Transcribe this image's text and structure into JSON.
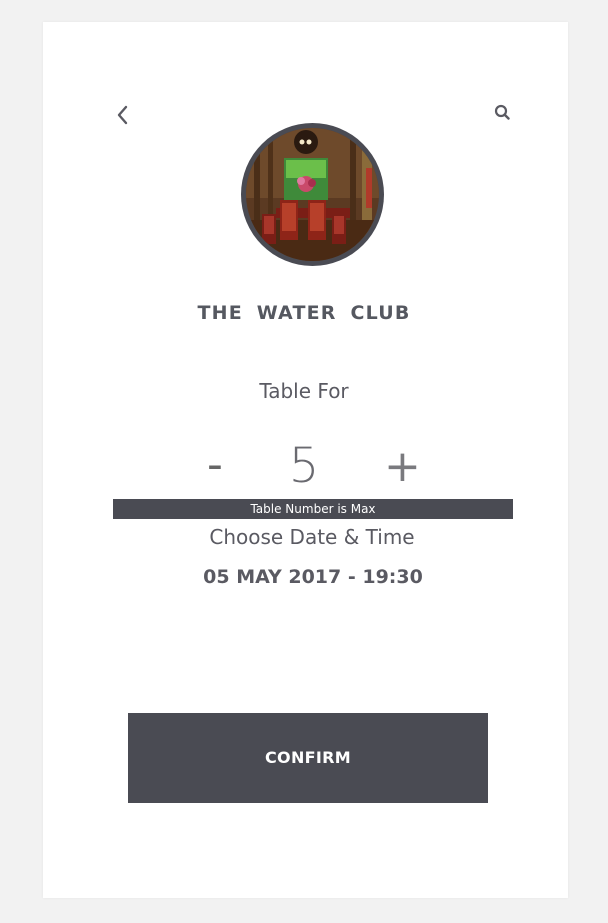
{
  "header": {
    "back_icon": "chevron-left-icon",
    "search_icon": "search-icon"
  },
  "restaurant": {
    "name": "THE  WATER  CLUB"
  },
  "booking": {
    "table_for_label": "Table For",
    "minus_label": "-",
    "party_size": "5",
    "plus_label": "+",
    "max_notice": "Table Number is Max",
    "choose_label": "Choose Date & Time",
    "datetime": "05 MAY 2017 - 19:30"
  },
  "actions": {
    "confirm_label": "CONFIRM"
  },
  "colors": {
    "accent": "#4a4b53",
    "text": "#5a5a62",
    "background": "#f2f2f2",
    "card": "#ffffff"
  }
}
